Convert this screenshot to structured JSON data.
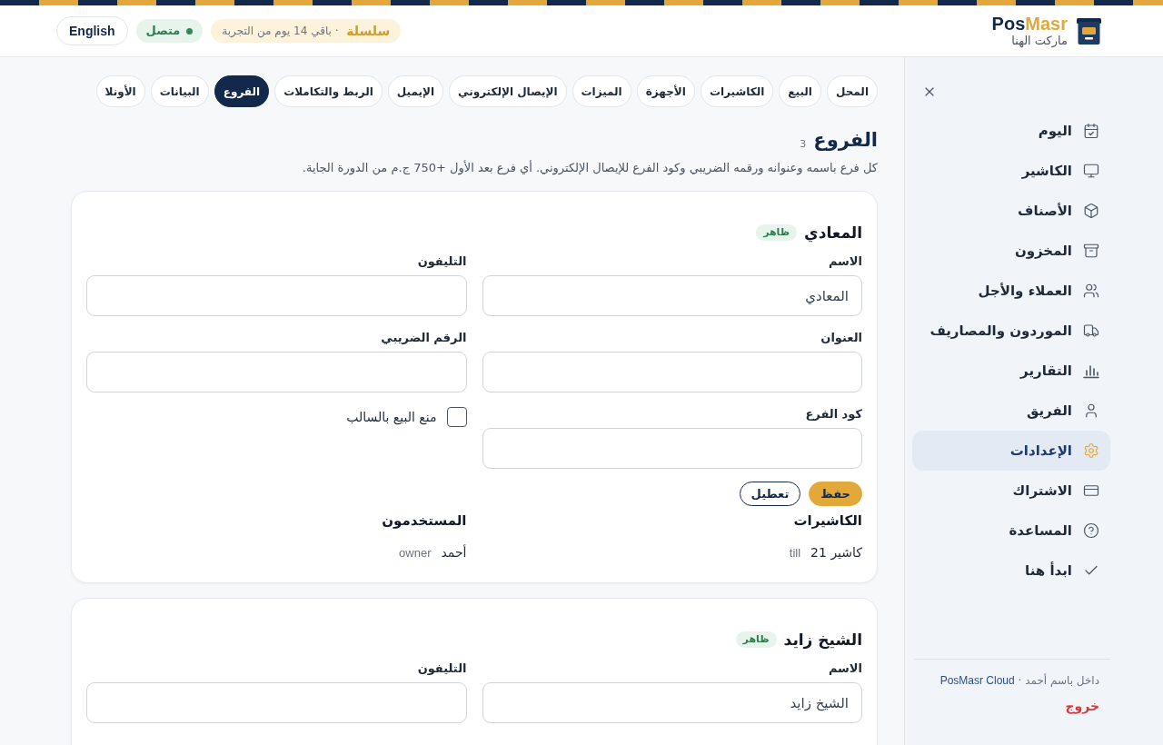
{
  "header": {
    "logo": {
      "name_part_1": "Pos",
      "name_part_2": "Masr",
      "store": "ماركت الهنا"
    },
    "plan_badge": "**سلسلة** · باقي 14 يوم من التجربة",
    "status": {
      "label": "متصل",
      "online": true
    },
    "language_button": "English"
  },
  "sidebar": {
    "items": [
      {
        "label": "اليوم",
        "selected": false
      },
      {
        "label": "الكاشير",
        "selected": false
      },
      {
        "label": "الأصناف",
        "selected": false
      },
      {
        "label": "المخزون",
        "selected": false
      },
      {
        "label": "العملاء والأجل",
        "selected": false
      },
      {
        "label": "الموردون والمصاريف",
        "selected": false
      },
      {
        "label": "التقارير",
        "selected": false
      },
      {
        "label": "الفريق",
        "selected": false
      },
      {
        "label": "الإعدادات",
        "selected": true
      },
      {
        "label": "الاشتراك",
        "selected": false
      },
      {
        "label": "المساعدة",
        "selected": false
      },
      {
        "label": "ابدأ هنا",
        "selected": false
      }
    ],
    "footer": {
      "signed_in": "داخل باسم أحمد ·",
      "link": "PosMasr Cloud",
      "logout": "خروج"
    }
  },
  "tabs": [
    {
      "label": "المحل",
      "selected": false
    },
    {
      "label": "البيع",
      "selected": false
    },
    {
      "label": "الكاشيرات",
      "selected": false
    },
    {
      "label": "الأجهزة",
      "selected": false
    },
    {
      "label": "الميزات",
      "selected": false
    },
    {
      "label": "الإيصال الإلكتروني",
      "selected": false
    },
    {
      "label": "الإيميل",
      "selected": false
    },
    {
      "label": "الربط والتكاملات",
      "selected": false
    },
    {
      "label": "الفروع",
      "selected": true
    },
    {
      "label": "البيانات",
      "selected": false
    },
    {
      "label": "الأونلا",
      "selected": false
    }
  ],
  "section": {
    "title": "الفروع",
    "count": "3",
    "description": "كل فرع باسمه وعنوانه ورقمه الضريبي وكود الفرع للإيصال الإلكتروني. أي فرع بعد الأول +750 ج.م من الدورة الجاية."
  },
  "branches": [
    {
      "name": "المعادي",
      "badge": "ظاهر",
      "fields": [
        {
          "kind": "text",
          "label": "الاسم",
          "value": "المعادي"
        },
        {
          "kind": "text",
          "label": "التليفون"
        },
        {
          "kind": "text",
          "label": "العنوان"
        },
        {
          "kind": "text",
          "label": "الرقم الضريبي"
        },
        {
          "kind": "text",
          "label": "كود الفرع"
        },
        {
          "kind": "checkbox",
          "label": "منع البيع بالسالب",
          "checked": false
        }
      ],
      "buttons": [
        {
          "label": "حفظ",
          "kind": "primary"
        },
        {
          "label": "تعطيل",
          "kind": "outline"
        }
      ],
      "lists": [
        {
          "title": "الكاشيرات",
          "rows": [
            {
              "name": "كاشير 21",
              "role": "till"
            }
          ]
        },
        {
          "title": "المستخدمون",
          "rows": [
            {
              "name": "أحمد",
              "role": "owner"
            }
          ]
        }
      ]
    },
    {
      "name": "الشيخ زايد",
      "badge": "ظاهر",
      "fields": [
        {
          "kind": "text",
          "label": "الاسم",
          "value": "الشيخ زايد"
        },
        {
          "kind": "text",
          "label": "التليفون"
        }
      ]
    }
  ]
}
